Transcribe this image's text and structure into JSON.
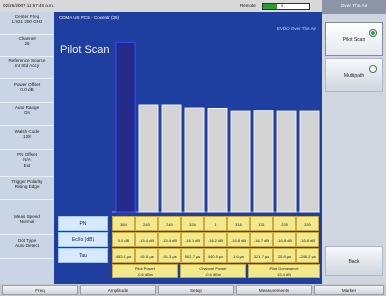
{
  "status_bar": {
    "datetime": "02/26/2007 11:57:49 a.m.",
    "remote_label": "Remote",
    "battery_value": "5"
  },
  "left_params": [
    {
      "label": "Center Freq",
      "value": "1.931 250 GHz"
    },
    {
      "label": "Channel",
      "value": "25"
    },
    {
      "label": "Reference Source",
      "value": "Int Std Accy"
    },
    {
      "label": "Power Offset",
      "value": "0.0 dB"
    },
    {
      "label": "Auto Range",
      "value": "On"
    },
    {
      "label": "Walsh Code",
      "value": "128"
    },
    {
      "label": "PN Offset",
      "value": "N/A",
      "extra": "Ext"
    },
    {
      "label": "Trigger Polarity",
      "value": "Rising Edge"
    },
    {
      "label": "Meas Speed",
      "value": "Normal"
    },
    {
      "label": "Dot Type",
      "value": "Auto Detect"
    }
  ],
  "main": {
    "channel_title": "CDMA US PCS - Coventr (25)",
    "overlay": "EVDO Over The Air",
    "title": "Pilot Scan"
  },
  "chart_data": {
    "type": "bar",
    "categories": [
      "384",
      "240",
      "240",
      "326",
      "1",
      "316",
      "131",
      "225",
      "330"
    ],
    "values": [
      -1.0,
      -15.4,
      -15.4,
      -16.1,
      -16.2,
      -16.8,
      -16.7,
      -16.8,
      -16.8
    ],
    "ylim": [
      -40,
      0
    ],
    "title": "",
    "xlabel": "",
    "ylabel": "",
    "colors": {
      "pilot": "#232a8a",
      "others": "#d4d4d4"
    }
  },
  "table": {
    "row_labels": [
      "PN",
      "Ec/Io (dB)",
      "Tau"
    ],
    "pn": [
      "384",
      "240",
      "240",
      "326",
      "1",
      "316",
      "131",
      "225",
      "330"
    ],
    "ecio": [
      "0.0 dB",
      "-15.4 dB",
      "-15.4 dB",
      "-16.1 dB",
      "-16.2 dB",
      "-16.8 dB",
      "-16.7 dB",
      "-16.8 dB",
      "-16.8 dB"
    ],
    "tau": [
      "453.1 µs",
      "-91.6 µs",
      "-91.3 µs",
      "502.7 µs",
      "440.9 µs",
      "1.6 µs",
      "321.7 µs",
      "25.8 µs",
      "-246.2 µs"
    ],
    "summary": [
      {
        "label": "Pilot Power",
        "value": "-0.6 dBm"
      },
      {
        "label": "Channel Power",
        "value": "-0.6 dBm"
      },
      {
        "label": "Pilot Dominance",
        "value": "15.4 dB"
      }
    ]
  },
  "right_menu": {
    "title": "Over The Air",
    "buttons": [
      {
        "label": "Pilot Scan",
        "active": true
      },
      {
        "label": "Multipath",
        "active": false
      }
    ],
    "back_label": "Back"
  },
  "softkeys": [
    "Freq",
    "Amplitude",
    "Setup",
    "Measurements",
    "Marker"
  ]
}
